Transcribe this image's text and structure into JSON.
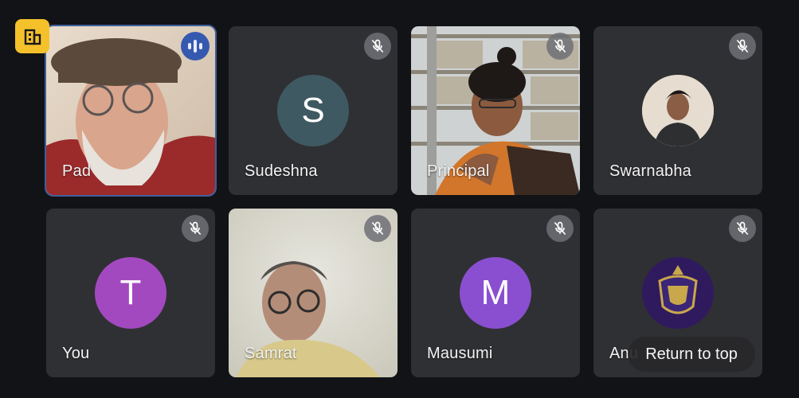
{
  "app_badge": {
    "icon": "building-icon",
    "color": "#f5c12b"
  },
  "participants": [
    {
      "name": "Pad",
      "state": "speaking",
      "view": "video"
    },
    {
      "name": "Sudeshna",
      "state": "muted",
      "view": "avatar",
      "initial": "S",
      "avatar_color": "#3f5962"
    },
    {
      "name": "Principal",
      "state": "muted",
      "view": "video"
    },
    {
      "name": "Swarnabha",
      "state": "muted",
      "view": "photo-avatar"
    },
    {
      "name": "You",
      "state": "muted",
      "view": "avatar",
      "initial": "T",
      "avatar_color": "#a349bf"
    },
    {
      "name": "Samrat",
      "state": "muted",
      "view": "video"
    },
    {
      "name": "Mausumi",
      "state": "muted",
      "view": "avatar",
      "initial": "M",
      "avatar_color": "#8a4fd0"
    },
    {
      "name": "Anu",
      "state": "muted",
      "view": "logo-avatar"
    }
  ],
  "return_to_top": "Return to top",
  "colors": {
    "background": "#121316",
    "tile": "#2f3033",
    "speaking_border": "#3f5f9c"
  }
}
